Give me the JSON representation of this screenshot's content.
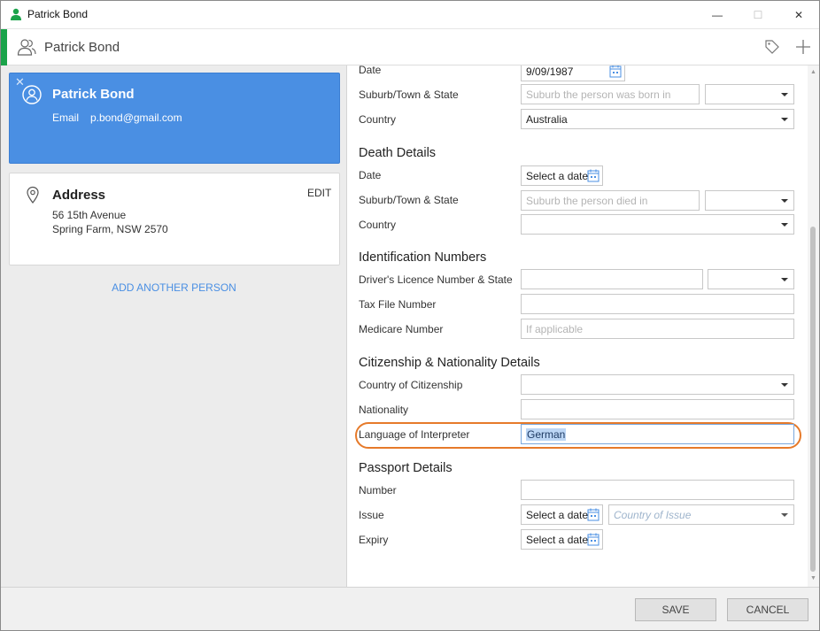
{
  "window": {
    "title": "Patrick Bond",
    "min_glyph": "—",
    "max_glyph": "☐",
    "close_glyph": "✕"
  },
  "header": {
    "name": "Patrick Bond"
  },
  "person_card": {
    "name": "Patrick Bond",
    "email_label": "Email",
    "email_value": "p.bond@gmail.com",
    "remove_glyph": "✕"
  },
  "address_card": {
    "title": "Address",
    "edit_label": "EDIT",
    "line1": "56 15th Avenue",
    "line2": "Spring Farm, NSW 2570"
  },
  "add_person_label": "ADD ANOTHER PERSON",
  "birth": {
    "date_label": "Date",
    "date_value": "9/09/1987",
    "suburb_label": "Suburb/Town & State",
    "suburb_placeholder": "Suburb the person was born in",
    "country_label": "Country",
    "country_value": "Australia"
  },
  "death": {
    "heading": "Death Details",
    "date_label": "Date",
    "date_button": "Select a date",
    "suburb_label": "Suburb/Town & State",
    "suburb_placeholder": "Suburb the person died in",
    "country_label": "Country"
  },
  "identification": {
    "heading": "Identification Numbers",
    "licence_label": "Driver's Licence Number & State",
    "tfn_label": "Tax File Number",
    "medicare_label": "Medicare Number",
    "medicare_placeholder": "If applicable"
  },
  "citizenship": {
    "heading": "Citizenship & Nationality Details",
    "country_label": "Country of Citizenship",
    "nationality_label": "Nationality",
    "interpreter_label": "Language of Interpreter",
    "interpreter_value": "German"
  },
  "passport": {
    "heading": "Passport Details",
    "number_label": "Number",
    "issue_label": "Issue",
    "issue_button": "Select a date",
    "country_placeholder": "Country of Issue",
    "expiry_label": "Expiry",
    "expiry_button": "Select a date"
  },
  "footer": {
    "save_label": "SAVE",
    "cancel_label": "CANCEL"
  },
  "colors": {
    "accent_green": "#1aa34a",
    "card_blue": "#4a8fe3",
    "highlight_orange": "#e67a2a"
  }
}
